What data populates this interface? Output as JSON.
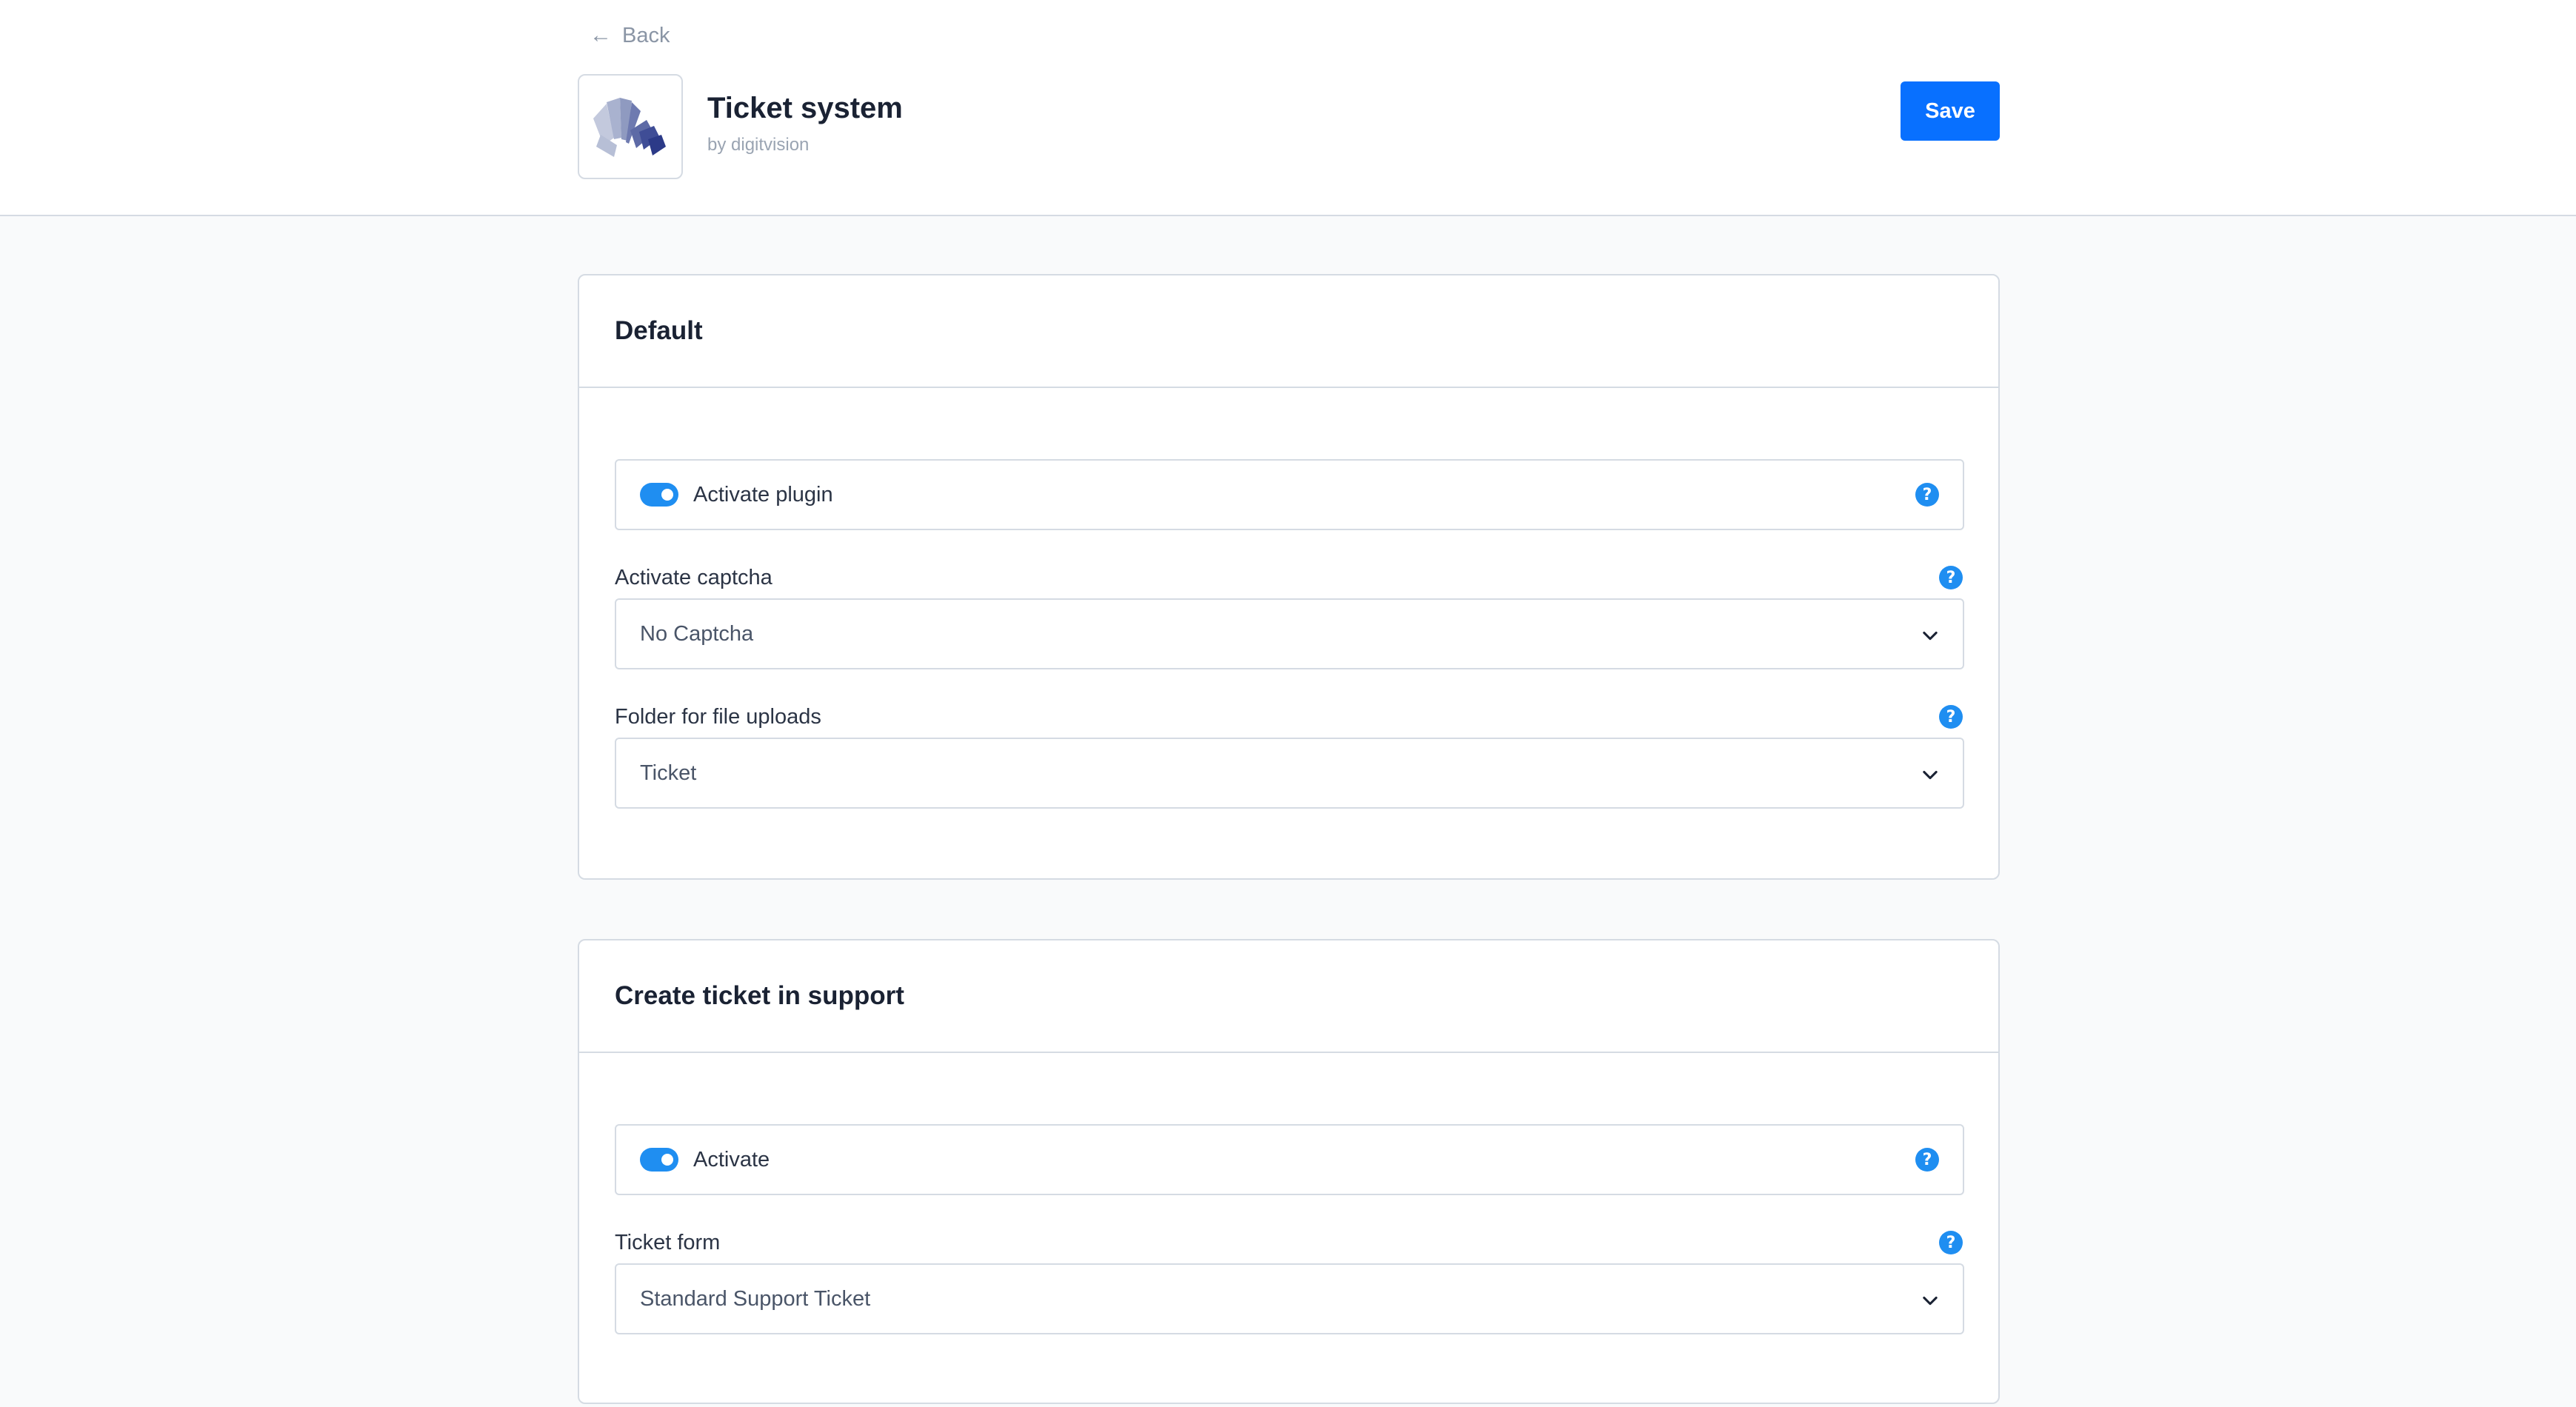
{
  "header": {
    "back_label": "Back",
    "app_title": "Ticket system",
    "app_vendor": "by digitvision",
    "save_label": "Save"
  },
  "sections": [
    {
      "title": "Default",
      "toggle_label": "Activate plugin",
      "toggle_on": true,
      "fields": [
        {
          "label": "Activate captcha",
          "value": "No Captcha"
        },
        {
          "label": "Folder for file uploads",
          "value": "Ticket"
        }
      ]
    },
    {
      "title": "Create ticket in support",
      "toggle_label": "Activate",
      "toggle_on": true,
      "fields": [
        {
          "label": "Ticket form",
          "value": "Standard Support Ticket"
        }
      ]
    }
  ],
  "icons": {
    "back": "arrow-left-icon",
    "help": "question-circle-icon",
    "select": "chevron-down-icon",
    "app": "digitvision-logo"
  },
  "colors": {
    "accent": "#0870ff",
    "toggle": "#1f8ef1",
    "border": "#d5dbe3",
    "background": "#f9fafb"
  }
}
